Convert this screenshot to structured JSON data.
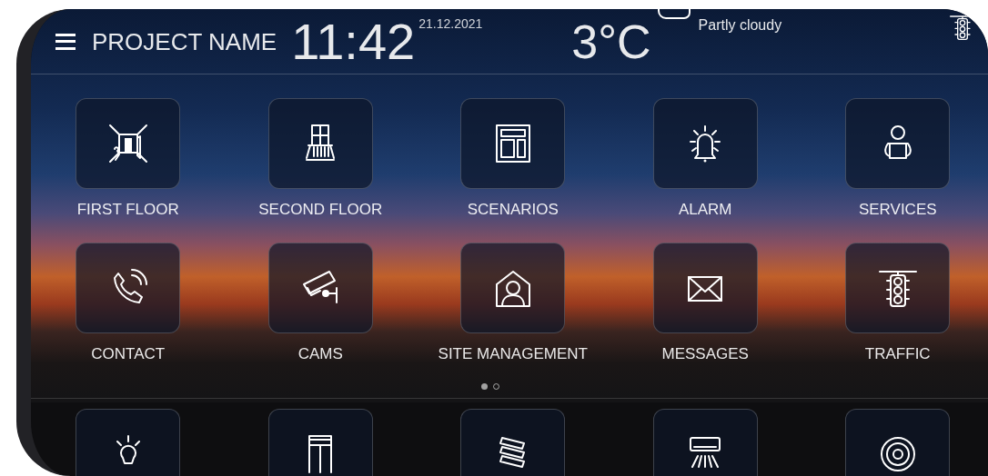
{
  "header": {
    "project_name": "PROJECT NAME",
    "time": "11:42",
    "date": "21.12.2021",
    "temperature": "3°C",
    "weather": "Partly cloudy"
  },
  "tiles": [
    {
      "label": "FIRST FLOOR"
    },
    {
      "label": "SECOND FLOOR"
    },
    {
      "label": "SCENARIOS"
    },
    {
      "label": "ALARM"
    },
    {
      "label": "SERVICES"
    },
    {
      "label": "CONTACT"
    },
    {
      "label": "CAMS"
    },
    {
      "label": "SITE MANAGEMENT"
    },
    {
      "label": "MESSAGES"
    },
    {
      "label": "TRAFFIC"
    }
  ],
  "pages": [
    {
      "selected": true
    },
    {
      "selected": false
    }
  ]
}
